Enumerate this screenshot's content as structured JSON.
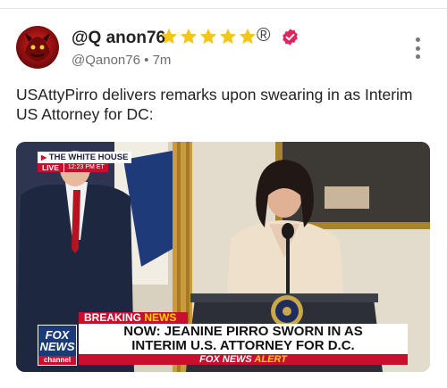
{
  "post": {
    "author_name": "@Q anon76",
    "star_count": 5,
    "registered_mark": "®",
    "handle": "@Qanon76",
    "separator": "•",
    "time_ago": "7m",
    "text": "USAttyPirro delivers remarks upon swearing in as Interim US Attorney for DC:",
    "icons": [
      "avatar",
      "star-icon",
      "verified-badge-icon",
      "more-options-icon"
    ]
  },
  "broadcast": {
    "source_label": "THE WHITE HOUSE",
    "live_label": "LIVE",
    "live_time": "12:23 PM ET",
    "breaking_label_1": "BREAKING",
    "breaking_label_2": "NEWS",
    "headline_line1": "NOW: JEANINE PIRRO SWORN IN AS",
    "headline_line2": "INTERIM U.S. ATTORNEY FOR D.C.",
    "alert_brand": "FOX NEWS",
    "alert_word": "ALERT",
    "logo_line1": "FOX",
    "logo_line2": "NEWS",
    "logo_line3": "channel"
  },
  "colors": {
    "star": "#f5c518",
    "verified": "#e0245e",
    "fox_red": "#c8102e",
    "fox_blue": "#1b3a7a",
    "accent_yellow": "#ffd200"
  }
}
